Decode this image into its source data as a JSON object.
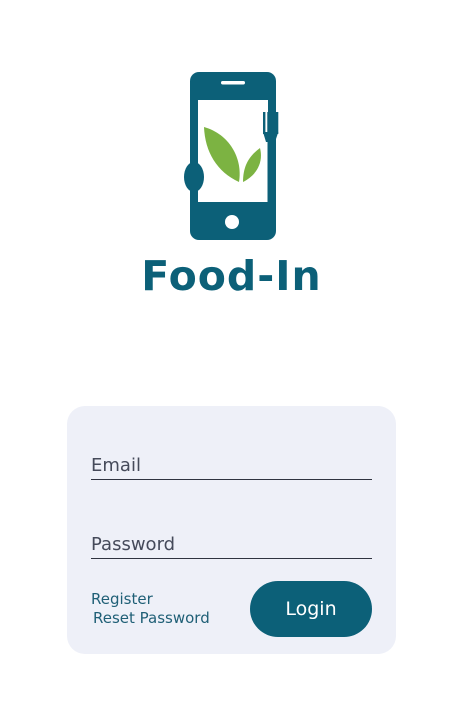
{
  "brand": {
    "name": "Food-In",
    "logo_icon": "phone-utensils-leaf-icon",
    "color": "#0c6078",
    "leaf_color": "#7cb342"
  },
  "login_form": {
    "email_placeholder": "Email",
    "password_placeholder": "Password",
    "register_label": "Register",
    "reset_password_label": "Reset Password",
    "login_label": "Login",
    "card_background": "#eef0f8",
    "button_color": "#0c6078"
  }
}
